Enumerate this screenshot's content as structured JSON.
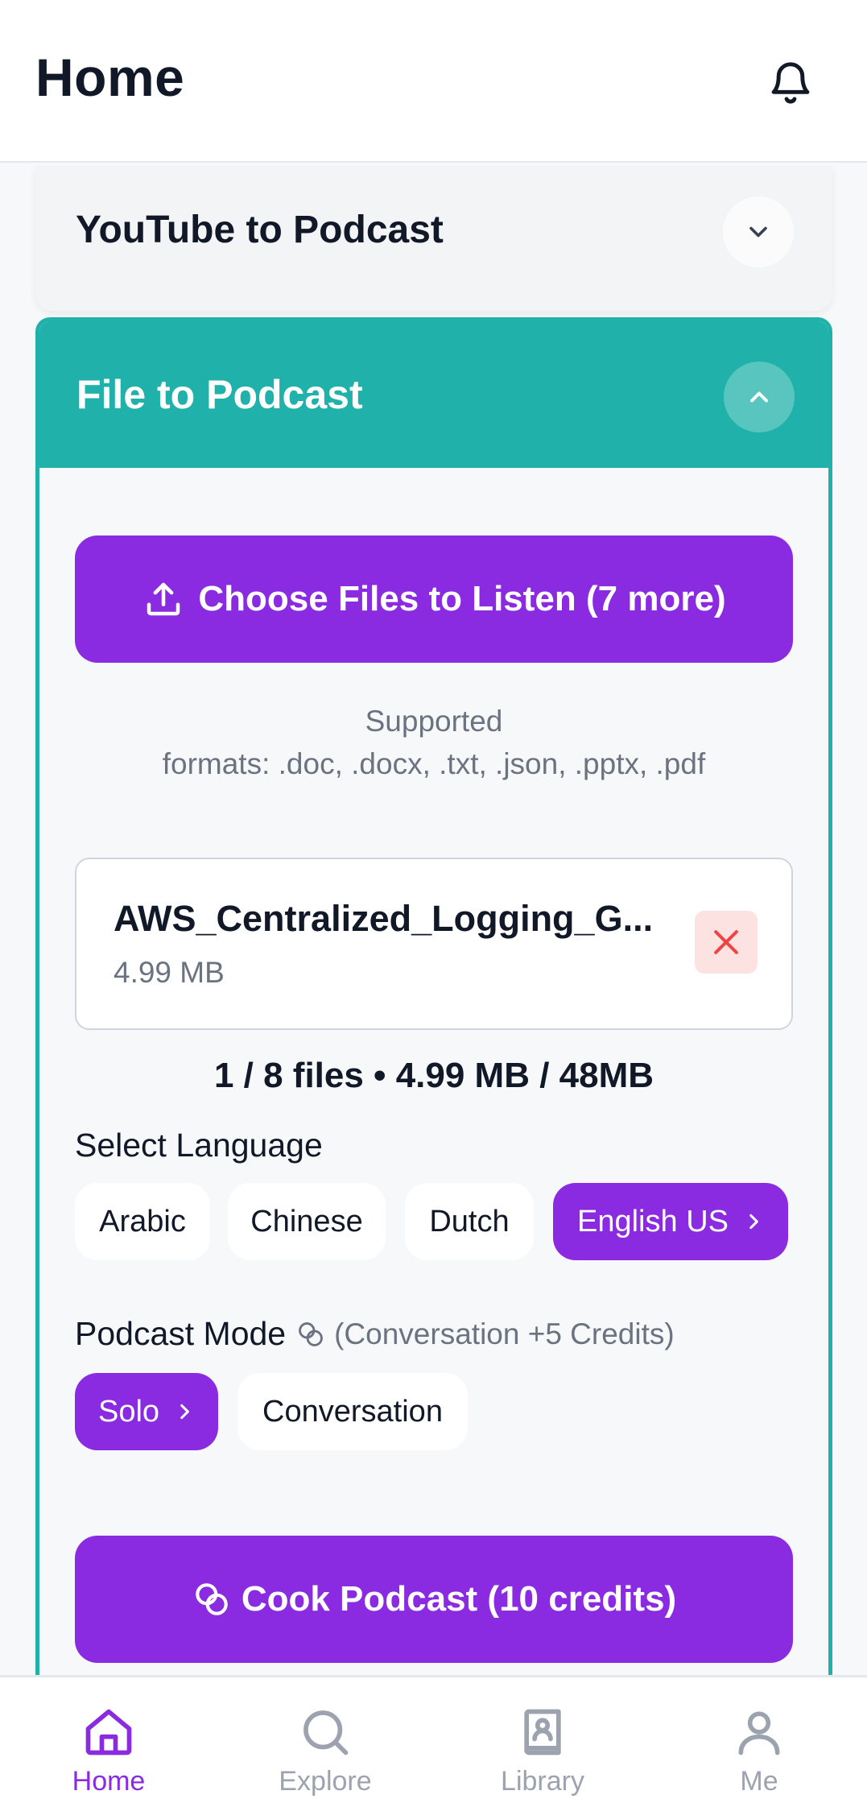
{
  "header": {
    "title": "Home"
  },
  "youtube_section": {
    "title": "YouTube to Podcast"
  },
  "file_section": {
    "title": "File to Podcast",
    "choose_button": "Choose Files to Listen (7 more)",
    "formats_line1": "Supported",
    "formats_line2": "formats: .doc, .docx, .txt, .json, .pptx, .pdf",
    "file": {
      "name": "AWS_Centralized_Logging_G...",
      "size": "4.99 MB"
    },
    "summary": "1 / 8 files • 4.99 MB / 48MB",
    "language_label": "Select Language",
    "languages": [
      "Arabic",
      "Chinese",
      "Dutch",
      "English US"
    ],
    "selected_language": "English US",
    "mode_label": "Podcast Mode",
    "mode_note": "(Conversation +5 Credits)",
    "modes": [
      "Solo",
      "Conversation"
    ],
    "selected_mode": "Solo",
    "cook_button": "Cook Podcast (10 credits)"
  },
  "nav": {
    "items": [
      {
        "label": "Home",
        "icon": "home-icon",
        "active": true
      },
      {
        "label": "Explore",
        "icon": "search-icon",
        "active": false
      },
      {
        "label": "Library",
        "icon": "library-icon",
        "active": false
      },
      {
        "label": "Me",
        "icon": "user-icon",
        "active": false
      }
    ]
  },
  "colors": {
    "accent": "#8a2be2",
    "teal": "#20b2aa",
    "danger": "#ef4444",
    "muted": "#9ca3af"
  }
}
